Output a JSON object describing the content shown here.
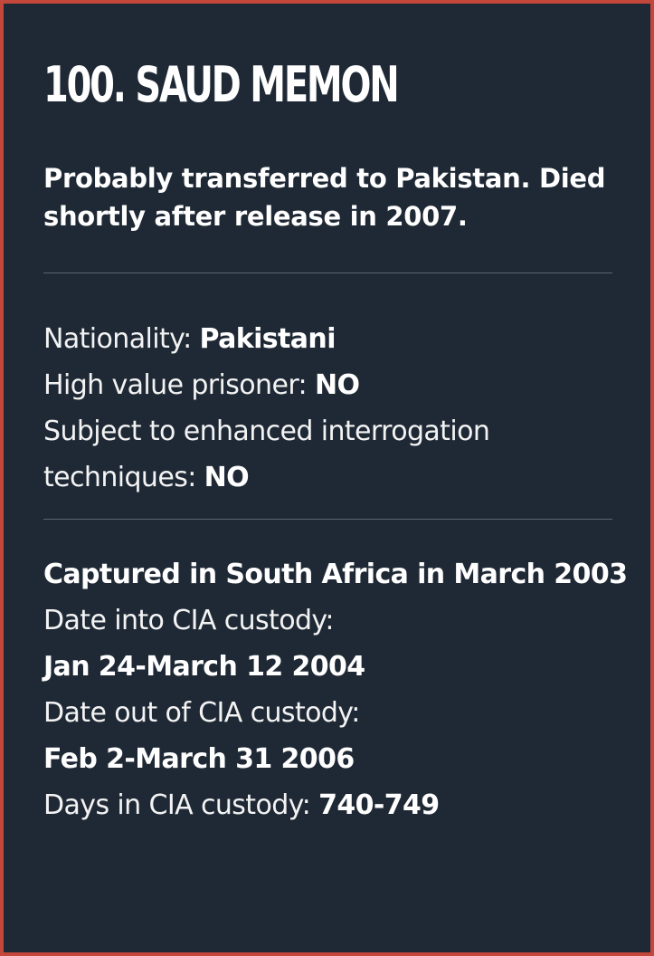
{
  "title": "100. SAUD MEMON",
  "summary": "Probably transferred to Pakistan. Died shortly after release in 2007.",
  "facts": {
    "nationality_label": "Nationality:",
    "nationality_value": "Pakistani",
    "high_value_label": "High value prisoner:",
    "high_value_value": "NO",
    "enhanced_label_line1": "Subject to enhanced interrogation",
    "enhanced_label_line2": "techniques:",
    "enhanced_value": "NO"
  },
  "custody": {
    "captured": "Captured in South Africa in March 2003",
    "date_in_label": "Date into CIA custody:",
    "date_in_value": "Jan 24-March 12 2004",
    "date_out_label": "Date out of CIA custody:",
    "date_out_value": "Feb 2-March 31 2006",
    "days_label": "Days in CIA custody:",
    "days_value": "740-749"
  },
  "colors": {
    "background": "#1f2935",
    "border": "#c4473b",
    "text": "#ffffff",
    "divider": "#5b6570"
  }
}
